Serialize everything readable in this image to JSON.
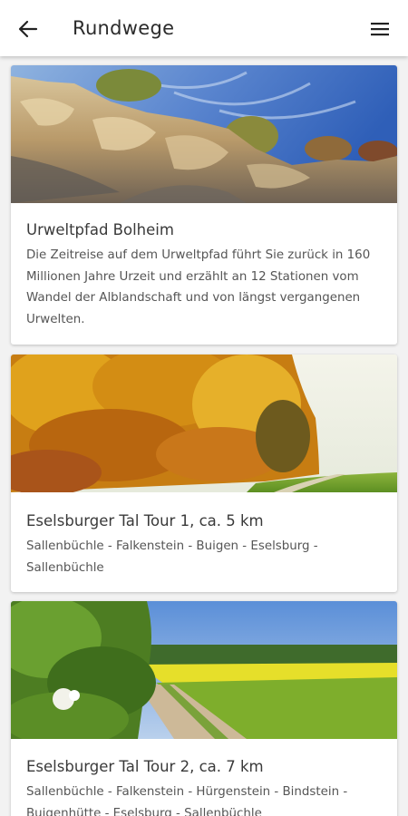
{
  "appbar": {
    "title": "Rundwege",
    "back_icon": "arrow-left-icon",
    "menu_icon": "hamburger-menu-icon"
  },
  "tours": [
    {
      "title": "Urweltpfad Bolheim",
      "description": "Die Zeitreise auf dem Urweltpfad führt Sie zurück in 160 Millionen Jahre Urzeit und erzählt an 12 Stationen vom Wandel der Alblandschaft und von längst vergangenen Urwelten.",
      "image": "rocky-cliff-photo"
    },
    {
      "title": "Eselsburger Tal Tour 1, ca. 5 km",
      "description": "Sallenbüchle - Falkenstein - Buigen - Eselsburg - Sallenbüchle",
      "image": "autumn-forest-photo"
    },
    {
      "title": "Eselsburger Tal Tour 2, ca. 7 km",
      "description": "Sallenbüchle - Falkenstein - Hürgenstein - Bindstein - Buigenhütte - Eselsburg - Sallenbüchle",
      "image": "field-path-photo"
    }
  ],
  "colors": {
    "background": "#f2f2f2",
    "card": "#ffffff",
    "title_text": "#2b2b2b"
  }
}
